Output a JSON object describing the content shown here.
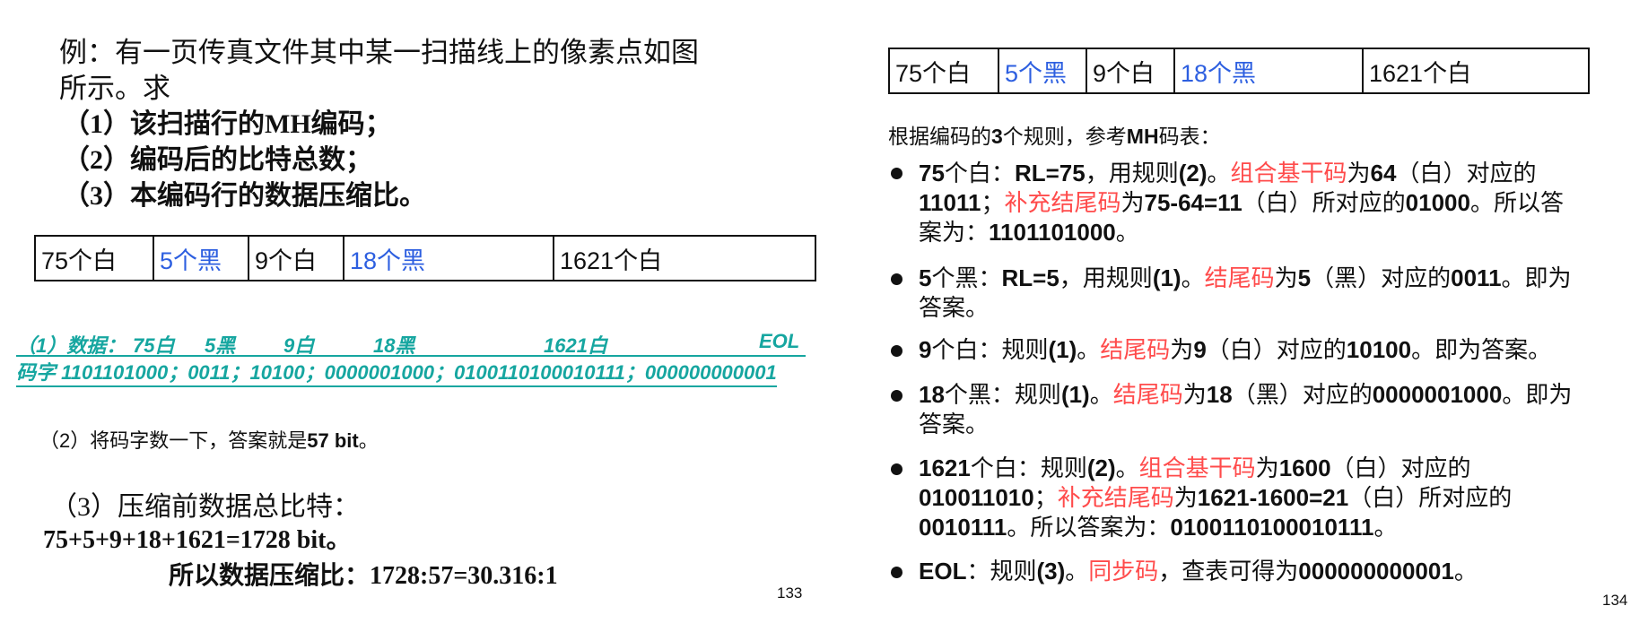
{
  "left": {
    "question": [
      "例：有一页传真文件其中某一扫描线上的像素点如图",
      "所示。求",
      "（1）该扫描行的MH编码；",
      "（2）编码后的比特总数；",
      "（3）本编码行的数据压缩比。"
    ],
    "pixel_table": [
      "75个白",
      "5个黑",
      "9个白",
      "18个黑",
      "1621个白"
    ],
    "answer1": {
      "prefix": "（1）数据：",
      "runs": [
        "75白",
        "5黑",
        "9白",
        "18黑",
        "1621白",
        "EOL"
      ],
      "codeword_line": "码字 1101101000；0011；10100；0000001000；0100110100010111；000000000001"
    },
    "answer2": {
      "prefix": "（2）将码字数一下，答案就是",
      "value": "57 bit",
      "suffix": "。"
    },
    "answer3": {
      "line1": "（3）压缩前数据总比特：",
      "line2": "75+5+9+18+1621=1728 bit。",
      "line3": "所以数据压缩比：1728:57=30.316:1"
    },
    "page_number": "133"
  },
  "right": {
    "pixel_table": [
      "75个白",
      "5个黑",
      "9个白",
      "18个黑",
      "1621个白"
    ],
    "intro": {
      "a": "根据编码的",
      "b": "3",
      "c": "个规则，参考",
      "d": "MH",
      "e": "码表："
    },
    "bullets": {
      "b1": {
        "p1": "75",
        "p2": "个白：",
        "p3": "RL=75",
        "p4": "，用规则",
        "p5": "(2)",
        "p6": "。",
        "red1": "组合基干码",
        "p7": "为",
        "p8": "64",
        "p9": "（白）对应的",
        "p10": "11011",
        "p11": "；",
        "red2": "补充结尾码",
        "p12": "为",
        "p13": "75-64=11",
        "p14": "（白）所对应的",
        "p15": "01000",
        "p16": "。所以答",
        "p17": "案为：",
        "p18": "1101101000",
        "p19": "。"
      },
      "b2": {
        "p1": "5",
        "p2": "个黑：",
        "p3": "RL=5",
        "p4": "，用规则",
        "p5": "(1)",
        "p6": "。",
        "red1": "结尾码",
        "p7": "为",
        "p8": "5",
        "p9": "（黑）对应的",
        "p10": "0011",
        "p11": "。即为",
        "p12": "答案。"
      },
      "b3": {
        "p1": "9",
        "p2": "个白：规则",
        "p3": "(1)",
        "p4": "。",
        "red1": "结尾码",
        "p5": "为",
        "p6": "9",
        "p7": "（白）对应的",
        "p8": "10100",
        "p9": "。即为答案。"
      },
      "b4": {
        "p1": "18",
        "p2": "个黑：规则",
        "p3": "(1)",
        "p4": "。",
        "red1": "结尾码",
        "p5": "为",
        "p6": "18",
        "p7": "（黑）对应的",
        "p8": "0000001000",
        "p9": "。即为",
        "p10": "答案。"
      },
      "b5": {
        "p1": "1621",
        "p2": "个白：规则",
        "p3": "(2)",
        "p4": "。",
        "red1": "组合基干码",
        "p5": "为",
        "p6": "1600",
        "p7": "（白）对应的",
        "p8": "010011010",
        "p9": "；",
        "red2": "补充结尾码",
        "p10": "为",
        "p11": "1621-1600=21",
        "p12": "（白）所对应的",
        "p13": "0010111",
        "p14": "。所以答案为：",
        "p15": "0100110100010111",
        "p16": "。"
      },
      "b6": {
        "p1": "EOL",
        "p2": "：规则",
        "p3": "(3)",
        "p4": "。",
        "red1": "同步码",
        "p5": "，查表可得为",
        "p6": "000000000001",
        "p7": "。"
      }
    },
    "page_number": "134"
  }
}
